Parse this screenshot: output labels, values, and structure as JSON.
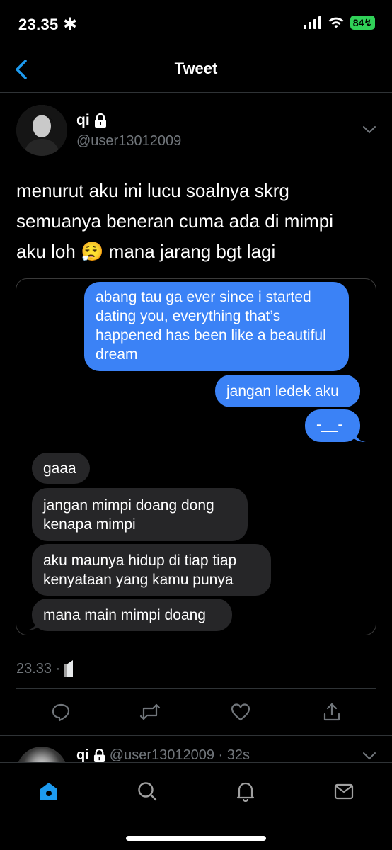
{
  "status_bar": {
    "time": "23.35",
    "battery": "84"
  },
  "nav": {
    "title": "Tweet"
  },
  "tweet": {
    "display_name": "qi",
    "handle": "@user13012009",
    "text_lines": [
      "menurut aku ini lucu soalnya skrg",
      "semuanya beneran cuma ada di mimpi",
      "aku loh 😮‍💨 mana jarang bgt lagi"
    ],
    "timestamp": "23.33 ·"
  },
  "media_chat": {
    "outgoing": [
      {
        "lines": [
          "abang tau ga ever since i started",
          "dating you, everything that’s",
          "happened has been like a beautiful",
          "dream"
        ]
      },
      {
        "lines": [
          "jangan ledek aku"
        ]
      },
      {
        "lines": [
          "-__-"
        ]
      }
    ],
    "incoming": [
      {
        "lines": [
          "gaaa"
        ]
      },
      {
        "lines": [
          "jangan mimpi doang dong",
          "kenapa mimpi"
        ]
      },
      {
        "lines": [
          "aku maunya hidup di tiap tiap",
          "kenyataan yang kamu punya"
        ]
      },
      {
        "lines": [
          "mana main mimpi doang"
        ]
      }
    ]
  },
  "reply_preview": {
    "display_name": "qi",
    "meta": "@user13012009 · 32s"
  },
  "icons": {
    "back": "chevron-left-icon",
    "more": "chevron-down-icon",
    "lock": "lock-icon",
    "reply": "reply-icon",
    "retweet": "retweet-icon",
    "like": "heart-icon",
    "share": "share-icon",
    "home": "home-icon",
    "search": "search-icon",
    "notifications": "bell-icon",
    "messages": "mail-icon"
  },
  "colors": {
    "accent": "#1d9bf0",
    "outgoing_bubble": "#3b82f6",
    "incoming_bubble": "#262628",
    "muted_text": "#71767b",
    "battery": "#30d158"
  }
}
